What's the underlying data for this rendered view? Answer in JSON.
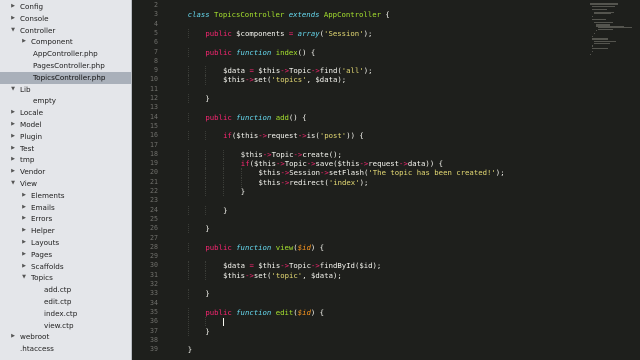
{
  "sidebar": {
    "items": [
      {
        "label": "Config",
        "depth": 0,
        "twisty": "closed"
      },
      {
        "label": "Console",
        "depth": 0,
        "twisty": "closed"
      },
      {
        "label": "Controller",
        "depth": 0,
        "twisty": "open"
      },
      {
        "label": "Component",
        "depth": 1,
        "twisty": "closed"
      },
      {
        "label": "AppController.php",
        "depth": 1,
        "twisty": "none"
      },
      {
        "label": "PagesController.php",
        "depth": 1,
        "twisty": "none"
      },
      {
        "label": "TopicsController.php",
        "depth": 1,
        "twisty": "none",
        "selected": true
      },
      {
        "label": "Lib",
        "depth": 0,
        "twisty": "open"
      },
      {
        "label": "empty",
        "depth": 1,
        "twisty": "none"
      },
      {
        "label": "Locale",
        "depth": 0,
        "twisty": "closed"
      },
      {
        "label": "Model",
        "depth": 0,
        "twisty": "closed"
      },
      {
        "label": "Plugin",
        "depth": 0,
        "twisty": "closed"
      },
      {
        "label": "Test",
        "depth": 0,
        "twisty": "closed"
      },
      {
        "label": "tmp",
        "depth": 0,
        "twisty": "closed"
      },
      {
        "label": "Vendor",
        "depth": 0,
        "twisty": "closed"
      },
      {
        "label": "View",
        "depth": 0,
        "twisty": "open"
      },
      {
        "label": "Elements",
        "depth": 1,
        "twisty": "closed"
      },
      {
        "label": "Emails",
        "depth": 1,
        "twisty": "closed"
      },
      {
        "label": "Errors",
        "depth": 1,
        "twisty": "closed"
      },
      {
        "label": "Helper",
        "depth": 1,
        "twisty": "closed"
      },
      {
        "label": "Layouts",
        "depth": 1,
        "twisty": "closed"
      },
      {
        "label": "Pages",
        "depth": 1,
        "twisty": "closed"
      },
      {
        "label": "Scaffolds",
        "depth": 1,
        "twisty": "closed"
      },
      {
        "label": "Topics",
        "depth": 1,
        "twisty": "open"
      },
      {
        "label": "add.ctp",
        "depth": 2,
        "twisty": "none"
      },
      {
        "label": "edit.ctp",
        "depth": 2,
        "twisty": "none"
      },
      {
        "label": "index.ctp",
        "depth": 2,
        "twisty": "none"
      },
      {
        "label": "view.ctp",
        "depth": 2,
        "twisty": "none"
      },
      {
        "label": "webroot",
        "depth": 0,
        "twisty": "closed"
      },
      {
        "label": ".htaccess",
        "depth": 0,
        "twisty": "none"
      }
    ]
  },
  "editor": {
    "first_visible_line": 2,
    "cursor_line": 36,
    "lines": [
      [],
      [
        [
          "st",
          "class "
        ],
        [
          "cls",
          "TopicsController "
        ],
        [
          "st",
          "extends "
        ],
        [
          "cls",
          "AppController "
        ],
        [
          "pl",
          "{"
        ]
      ],
      [],
      [
        [
          "kw",
          "public "
        ],
        [
          "var",
          "$components "
        ],
        [
          "op",
          "= "
        ],
        [
          "st",
          "array"
        ],
        [
          "pl",
          "("
        ],
        [
          "str",
          "'Session'"
        ],
        [
          "pl",
          ");"
        ]
      ],
      [],
      [
        [
          "kw",
          "public "
        ],
        [
          "st",
          "function "
        ],
        [
          "fn",
          "index"
        ],
        [
          "pl",
          "() {"
        ]
      ],
      [],
      [
        [
          "var",
          "$data "
        ],
        [
          "op",
          "= "
        ],
        [
          "this",
          "$this"
        ],
        [
          "op",
          "->"
        ],
        [
          "prop",
          "Topic"
        ],
        [
          "op",
          "->"
        ],
        [
          "prop",
          "find"
        ],
        [
          "pl",
          "("
        ],
        [
          "str",
          "'all'"
        ],
        [
          "pl",
          ");"
        ]
      ],
      [
        [
          "this",
          "$this"
        ],
        [
          "op",
          "->"
        ],
        [
          "prop",
          "set"
        ],
        [
          "pl",
          "("
        ],
        [
          "str",
          "'topics'"
        ],
        [
          "pl",
          ", "
        ],
        [
          "var",
          "$data"
        ],
        [
          "pl",
          ");"
        ]
      ],
      [],
      [
        [
          "pl",
          "}"
        ]
      ],
      [],
      [
        [
          "kw",
          "public "
        ],
        [
          "st",
          "function "
        ],
        [
          "fn",
          "add"
        ],
        [
          "pl",
          "() {"
        ]
      ],
      [],
      [
        [
          "kw",
          "if"
        ],
        [
          "pl",
          "("
        ],
        [
          "this",
          "$this"
        ],
        [
          "op",
          "->"
        ],
        [
          "prop",
          "request"
        ],
        [
          "op",
          "->"
        ],
        [
          "prop",
          "is"
        ],
        [
          "pl",
          "("
        ],
        [
          "str",
          "'post'"
        ],
        [
          "pl",
          ")) {"
        ]
      ],
      [],
      [
        [
          "this",
          "$this"
        ],
        [
          "op",
          "->"
        ],
        [
          "prop",
          "Topic"
        ],
        [
          "op",
          "->"
        ],
        [
          "prop",
          "create"
        ],
        [
          "pl",
          "();"
        ]
      ],
      [
        [
          "kw",
          "if"
        ],
        [
          "pl",
          "("
        ],
        [
          "this",
          "$this"
        ],
        [
          "op",
          "->"
        ],
        [
          "prop",
          "Topic"
        ],
        [
          "op",
          "->"
        ],
        [
          "prop",
          "save"
        ],
        [
          "pl",
          "("
        ],
        [
          "this",
          "$this"
        ],
        [
          "op",
          "->"
        ],
        [
          "prop",
          "request"
        ],
        [
          "op",
          "->"
        ],
        [
          "prop",
          "data"
        ],
        [
          "pl",
          ")) {"
        ]
      ],
      [
        [
          "this",
          "$this"
        ],
        [
          "op",
          "->"
        ],
        [
          "prop",
          "Session"
        ],
        [
          "op",
          "->"
        ],
        [
          "prop",
          "setFlash"
        ],
        [
          "pl",
          "("
        ],
        [
          "str",
          "'The topic has been created!'"
        ],
        [
          "pl",
          ");"
        ]
      ],
      [
        [
          "this",
          "$this"
        ],
        [
          "op",
          "->"
        ],
        [
          "prop",
          "redirect"
        ],
        [
          "pl",
          "("
        ],
        [
          "str",
          "'index'"
        ],
        [
          "pl",
          ");"
        ]
      ],
      [
        [
          "pl",
          "}"
        ]
      ],
      [],
      [
        [
          "pl",
          "}"
        ]
      ],
      [],
      [
        [
          "pl",
          "}"
        ]
      ],
      [],
      [
        [
          "kw",
          "public "
        ],
        [
          "st",
          "function "
        ],
        [
          "fn",
          "view"
        ],
        [
          "pl",
          "("
        ],
        [
          "arg",
          "$id"
        ],
        [
          "pl",
          ") {"
        ]
      ],
      [],
      [
        [
          "var",
          "$data "
        ],
        [
          "op",
          "= "
        ],
        [
          "this",
          "$this"
        ],
        [
          "op",
          "->"
        ],
        [
          "prop",
          "Topic"
        ],
        [
          "op",
          "->"
        ],
        [
          "prop",
          "findById"
        ],
        [
          "pl",
          "("
        ],
        [
          "var",
          "$id"
        ],
        [
          "pl",
          ");"
        ]
      ],
      [
        [
          "this",
          "$this"
        ],
        [
          "op",
          "->"
        ],
        [
          "prop",
          "set"
        ],
        [
          "pl",
          "("
        ],
        [
          "str",
          "'topic'"
        ],
        [
          "pl",
          ", "
        ],
        [
          "var",
          "$data"
        ],
        [
          "pl",
          ");"
        ]
      ],
      [],
      [
        [
          "pl",
          "}"
        ]
      ],
      [],
      [
        [
          "kw",
          "public "
        ],
        [
          "st",
          "function "
        ],
        [
          "fn",
          "edit"
        ],
        [
          "pl",
          "("
        ],
        [
          "arg",
          "$id"
        ],
        [
          "pl",
          ") {"
        ]
      ],
      [],
      [
        [
          "pl",
          "}"
        ]
      ],
      [],
      [
        [
          "pl",
          "}"
        ]
      ]
    ],
    "indents": [
      0,
      1,
      0,
      2,
      0,
      2,
      0,
      3,
      3,
      0,
      2,
      0,
      2,
      0,
      3,
      0,
      4,
      4,
      5,
      5,
      4,
      0,
      3,
      0,
      2,
      0,
      2,
      0,
      3,
      3,
      0,
      2,
      0,
      2,
      3,
      2,
      0,
      1
    ]
  }
}
